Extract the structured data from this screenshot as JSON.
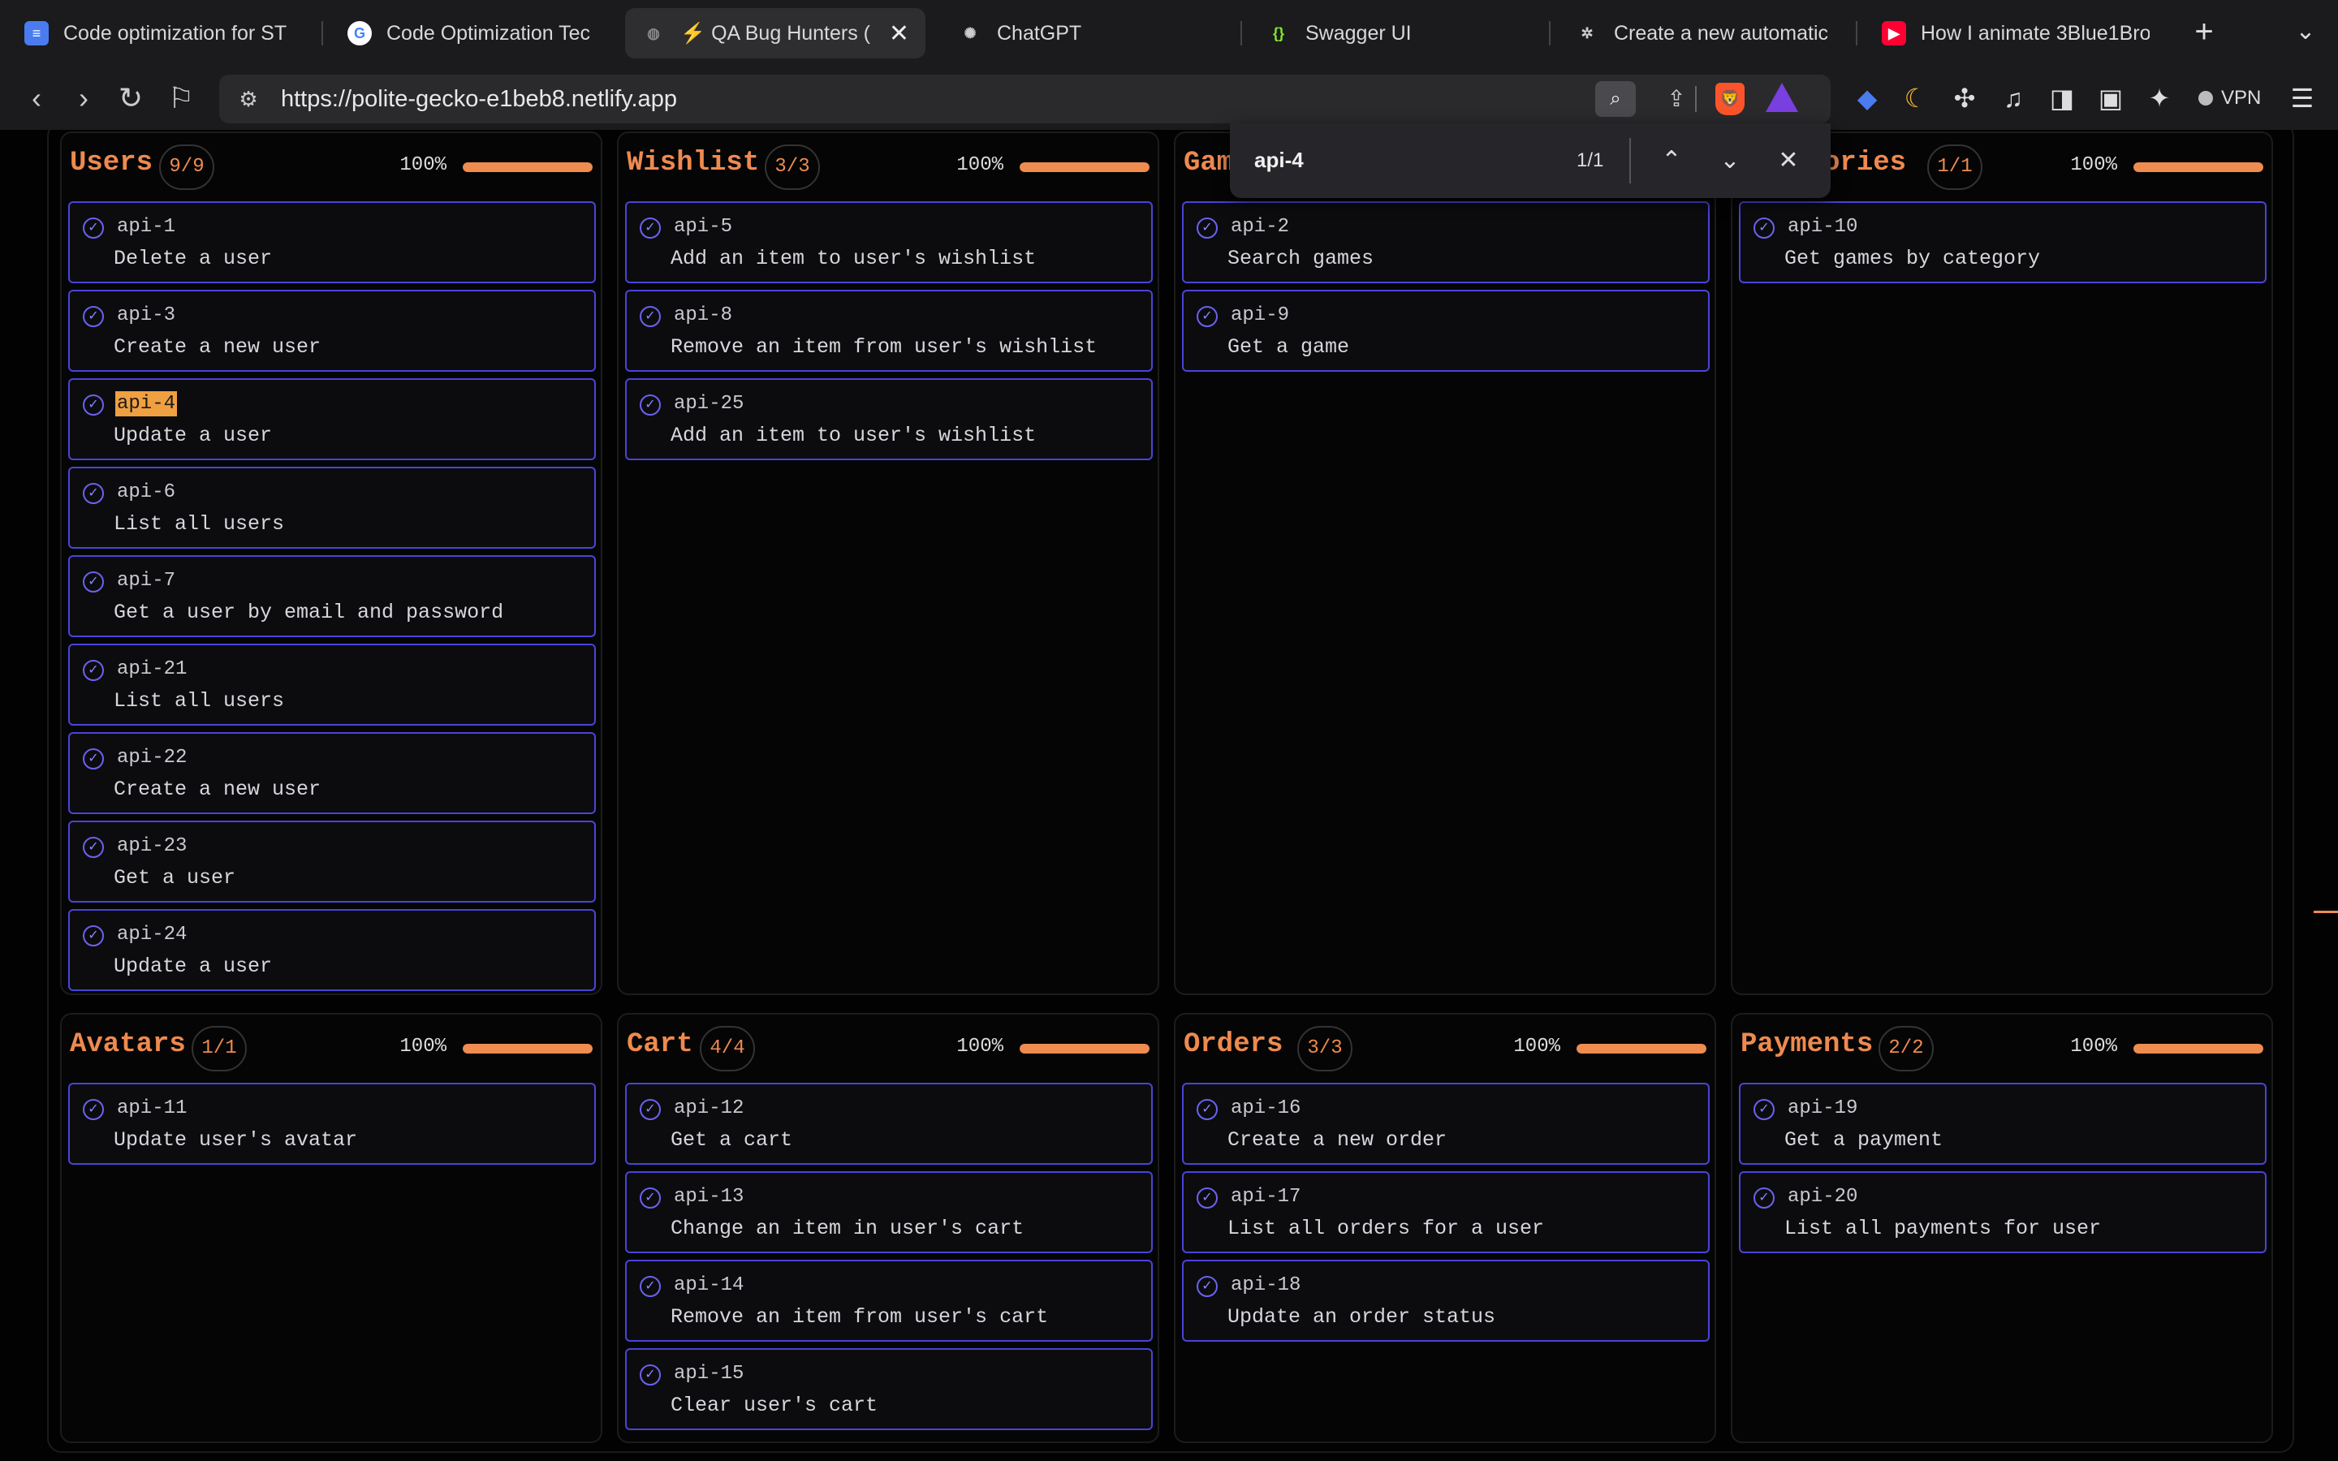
{
  "tabs": [
    {
      "title": "Code optimization for ST",
      "icon": "google-docs-icon",
      "color": "#4a7cf0"
    },
    {
      "title": "Code Optimization Techn",
      "icon": "google-icon",
      "color": "#ffffff"
    },
    {
      "title": "⚡ QA Bug Hunters (",
      "icon": "globe-icon",
      "color": "#888888",
      "active": true
    },
    {
      "title": "ChatGPT",
      "icon": "chatgpt-icon",
      "color": "#cccccc"
    },
    {
      "title": "Swagger UI",
      "icon": "swagger-icon",
      "color": "#85ea2d"
    },
    {
      "title": "Create a new automatic p",
      "icon": "gear-icon",
      "color": "#cccccc"
    },
    {
      "title": "How I animate 3Blue1Bro",
      "icon": "youtube-icon",
      "color": "#ff0033"
    }
  ],
  "address": {
    "url": "https://polite-gecko-e1beb8.netlify.app"
  },
  "vpn_label": "VPN",
  "find": {
    "query": "api-4",
    "result": "1/1"
  },
  "accent": "#ef8c50",
  "card_border": "#4a44d8",
  "columns": [
    {
      "title": "Users",
      "count": "9/9",
      "percent": "100%",
      "progress": 1.0,
      "cards": [
        {
          "id": "api-1",
          "desc": "Delete a user"
        },
        {
          "id": "api-3",
          "desc": "Create a new user"
        },
        {
          "id": "api-4",
          "desc": "Update a user",
          "highlight": true
        },
        {
          "id": "api-6",
          "desc": "List all users"
        },
        {
          "id": "api-7",
          "desc": "Get a user by email and password"
        },
        {
          "id": "api-21",
          "desc": "List all users"
        },
        {
          "id": "api-22",
          "desc": "Create a new user"
        },
        {
          "id": "api-23",
          "desc": "Get a user"
        },
        {
          "id": "api-24",
          "desc": "Update a user"
        }
      ]
    },
    {
      "title": "Wishlist",
      "count": "3/3",
      "percent": "100%",
      "progress": 1.0,
      "cards": [
        {
          "id": "api-5",
          "desc": "Add an item to user's wishlist"
        },
        {
          "id": "api-8",
          "desc": "Remove an item from user's wishlist"
        },
        {
          "id": "api-25",
          "desc": "Add an item to user's wishlist"
        }
      ]
    },
    {
      "title": "Games",
      "count": "",
      "percent": "",
      "progress": 1.0,
      "cards": [
        {
          "id": "api-2",
          "desc": "Search games"
        },
        {
          "id": "api-9",
          "desc": "Get a game"
        }
      ]
    },
    {
      "title": "Categories",
      "count": "1/1",
      "percent": "100%",
      "progress": 1.0,
      "cards": [
        {
          "id": "api-10",
          "desc": "Get games by category"
        }
      ]
    },
    {
      "title": "Avatars",
      "count": "1/1",
      "percent": "100%",
      "progress": 1.0,
      "cards": [
        {
          "id": "api-11",
          "desc": "Update user's avatar"
        }
      ]
    },
    {
      "title": "Cart",
      "count": "4/4",
      "percent": "100%",
      "progress": 1.0,
      "cards": [
        {
          "id": "api-12",
          "desc": "Get a cart"
        },
        {
          "id": "api-13",
          "desc": "Change an item in user's cart"
        },
        {
          "id": "api-14",
          "desc": "Remove an item from user's cart"
        },
        {
          "id": "api-15",
          "desc": "Clear user's cart"
        }
      ]
    },
    {
      "title": "Orders",
      "count": "3/3",
      "percent": "100%",
      "progress": 1.0,
      "cards": [
        {
          "id": "api-16",
          "desc": "Create a new order"
        },
        {
          "id": "api-17",
          "desc": "List all orders for a user"
        },
        {
          "id": "api-18",
          "desc": "Update an order status"
        }
      ]
    },
    {
      "title": "Payments",
      "count": "2/2",
      "percent": "100%",
      "progress": 1.0,
      "cards": [
        {
          "id": "api-19",
          "desc": "Get a payment"
        },
        {
          "id": "api-20",
          "desc": "List all payments for user"
        }
      ]
    }
  ]
}
